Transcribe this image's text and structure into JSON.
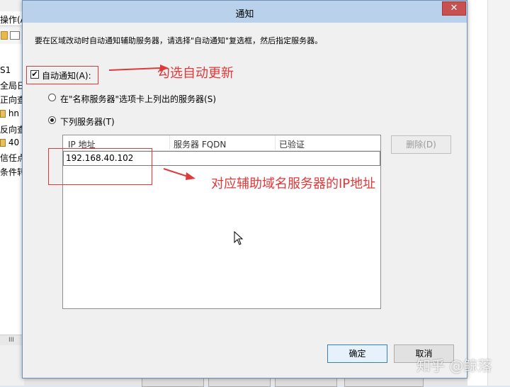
{
  "background": {
    "menu_label": "操作(A",
    "tree_items": [
      "S1",
      "全局日",
      "正向查",
      "hn",
      "反向查",
      "40",
      "信任点",
      "条件转"
    ],
    "scroll_glyph": "III"
  },
  "dialog": {
    "title": "通知",
    "close_glyph": "✕",
    "instruction": "要在区域改动时自动通知辅助服务器，请选择\"自动通知\"复选框，然后指定服务器。",
    "auto_notify": {
      "label": "自动通知(A):",
      "checked": true
    },
    "options": [
      {
        "label": "在\"名称服务器\"选项卡上列出的服务器(S)",
        "selected": false
      },
      {
        "label": "下列服务器(T)",
        "selected": true
      }
    ],
    "list": {
      "columns": [
        "IP 地址",
        "服务器 FQDN",
        "已验证"
      ],
      "edit_value": "192.168.40.102"
    },
    "delete_button": "删除(D)",
    "ok_button": "确定",
    "cancel_button": "取消"
  },
  "annotations": {
    "check_auto_update": "勾选自动更新",
    "ip_note": "对应辅助域名服务器的IP地址",
    "color": "#e0393a"
  },
  "watermark": "知乎 @鲸落"
}
